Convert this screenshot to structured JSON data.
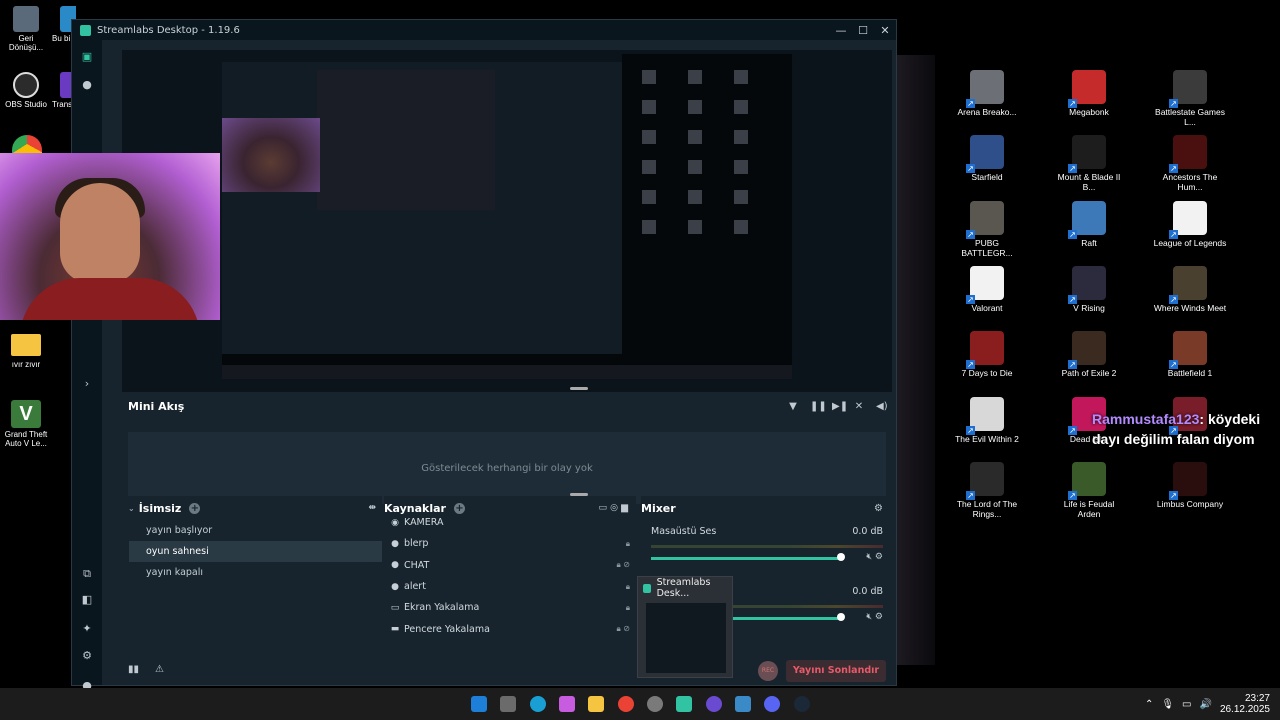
{
  "window": {
    "title": "Streamlabs Desktop - 1.19.6",
    "controls": {
      "minimize": "—",
      "maximize": "☐",
      "close": "✕"
    }
  },
  "mini_akis": {
    "title": "Mini Akış",
    "empty_text": "Gösterilecek herhangi bir olay yok"
  },
  "scenes": {
    "title": "İsimsiz",
    "items": [
      "yayın başlıyor",
      "oyun sahnesi",
      "yayın kapalı"
    ],
    "active_index": 1
  },
  "sources": {
    "title": "Kaynaklar",
    "items": [
      {
        "label": "KAMERA",
        "icon": "camera-icon"
      },
      {
        "label": "blerp",
        "icon": "globe-icon"
      },
      {
        "label": "CHAT",
        "icon": "globe-icon"
      },
      {
        "label": "alert",
        "icon": "globe-icon"
      },
      {
        "label": "Ekran Yakalama",
        "icon": "monitor-icon"
      },
      {
        "label": "Pencere Yakalama",
        "icon": "window-icon"
      }
    ]
  },
  "mixer": {
    "title": "Mixer",
    "channels": [
      {
        "name": "Masaüstü Ses",
        "db": "0.0 dB"
      },
      {
        "name": "",
        "db": "0.0 dB"
      }
    ]
  },
  "footer": {
    "end_stream": "Yayını Sonlandır",
    "rec": "REC"
  },
  "thumbnail": {
    "title": "Streamlabs Desk..."
  },
  "overlay_chat": {
    "user": "Rammustafa123",
    "message": ": köydeki dayı değilim falan diyom"
  },
  "desktop_icons": [
    {
      "label": "Arena Breako...",
      "color": "#6d6f76"
    },
    {
      "label": "Megabonk",
      "color": "#c52b2b"
    },
    {
      "label": "Battlestate Games L...",
      "color": "#3b3b3b"
    },
    {
      "label": "Starfield",
      "color": "#2f4f8a"
    },
    {
      "label": "Mount & Blade II B...",
      "color": "#1d1d1d"
    },
    {
      "label": "Ancestors The Hum...",
      "color": "#4a1010"
    },
    {
      "label": "PUBG BATTLEGR...",
      "color": "#5a5650"
    },
    {
      "label": "Raft",
      "color": "#3d78b8"
    },
    {
      "label": "League of Legends",
      "color": "#f2f2f2"
    },
    {
      "label": "Valorant",
      "color": "#f2f2f2"
    },
    {
      "label": "V Rising",
      "color": "#2b2b3d"
    },
    {
      "label": "Where Winds Meet",
      "color": "#4a4030"
    },
    {
      "label": "7 Days to Die",
      "color": "#8a1d1d"
    },
    {
      "label": "Path of Exile 2",
      "color": "#3a2a20"
    },
    {
      "label": "Battlefield 1",
      "color": "#7a3a28"
    },
    {
      "label": "The Evil Within 2",
      "color": "#d8d8d8"
    },
    {
      "label": "Dead Isl...",
      "color": "#c2185b"
    },
    {
      "label": "",
      "color": "#7a1d2a"
    },
    {
      "label": "The Lord of The Rings...",
      "color": "#2a2a2a"
    },
    {
      "label": "Life is Feudal Arden",
      "color": "#3b5a2a"
    },
    {
      "label": "Limbus Company",
      "color": "#2a0d0d"
    }
  ],
  "left_icons": [
    {
      "label": "Geri Dönüşü...",
      "color": "#5a6a7a"
    },
    {
      "label": "Bu bi...",
      "color": "#2a8ac8"
    },
    {
      "label": "OBS Studio",
      "color": "#2b2b2b"
    },
    {
      "label": "Trans...",
      "color": "#6a3ac2"
    },
    {
      "label": "ıvır zıvır",
      "color": "#f5c542"
    },
    {
      "label": "Grand Theft Auto V Le...",
      "color": "#3a7a3a"
    }
  ],
  "tray": {
    "time": "23:27",
    "date": "26.12.2025",
    "chevron": "⌃",
    "mic": "🎙",
    "net": "▭",
    "vol": "🔊"
  }
}
